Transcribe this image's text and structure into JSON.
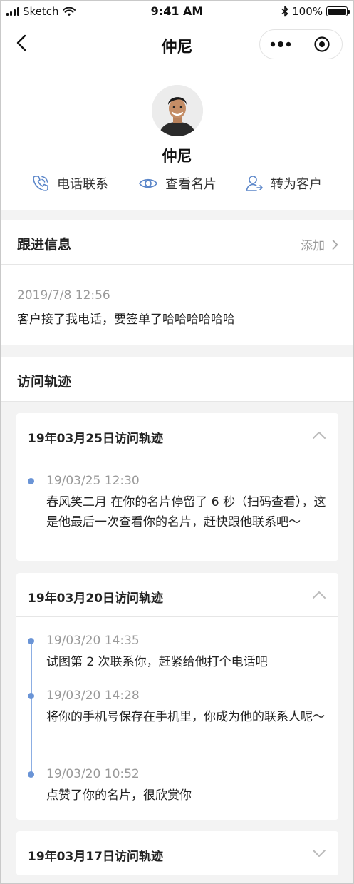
{
  "status_bar": {
    "carrier": "Sketch",
    "time": "9:41 AM",
    "battery": "100%"
  },
  "nav": {
    "title": "仲尼"
  },
  "profile": {
    "name": "仲尼",
    "actions": [
      {
        "label": "电话联系",
        "icon": "phone-icon"
      },
      {
        "label": "查看名片",
        "icon": "eye-icon"
      },
      {
        "label": "转为客户",
        "icon": "user-convert-icon"
      }
    ]
  },
  "follow_up": {
    "title": "跟进信息",
    "add_label": "添加",
    "entry": {
      "date": "2019/7/8 12:56",
      "text": "客户接了我电话，要签单了哈哈哈哈哈哈"
    }
  },
  "visits": {
    "title": "访问轨迹",
    "groups": [
      {
        "title": "19年03月25日访问轨迹",
        "expanded": true,
        "items": [
          {
            "time": "19/03/25 12:30",
            "text": "春风笑二月 在你的名片停留了 6 秒（扫码查看），这是他最后一次查看你的名片，赶快跟他联系吧～"
          }
        ]
      },
      {
        "title": "19年03月20日访问轨迹",
        "expanded": true,
        "items": [
          {
            "time": "19/03/20 14:35",
            "text": "试图第 2 次联系你，赶紧给他打个电话吧"
          },
          {
            "time": "19/03/20 14:28",
            "text": "将你的手机号保存在手机里，你成为他的联系人呢～"
          },
          {
            "time": "19/03/20 10:52",
            "text": "点赞了你的名片，很欣赏你"
          }
        ]
      },
      {
        "title": "19年03月17日访问轨迹",
        "expanded": false,
        "items": []
      }
    ]
  },
  "colors": {
    "accent": "#6a94d6",
    "icon_blue": "#5b86c9",
    "muted_text": "#999999",
    "page_bg": "#f3f3f3"
  }
}
